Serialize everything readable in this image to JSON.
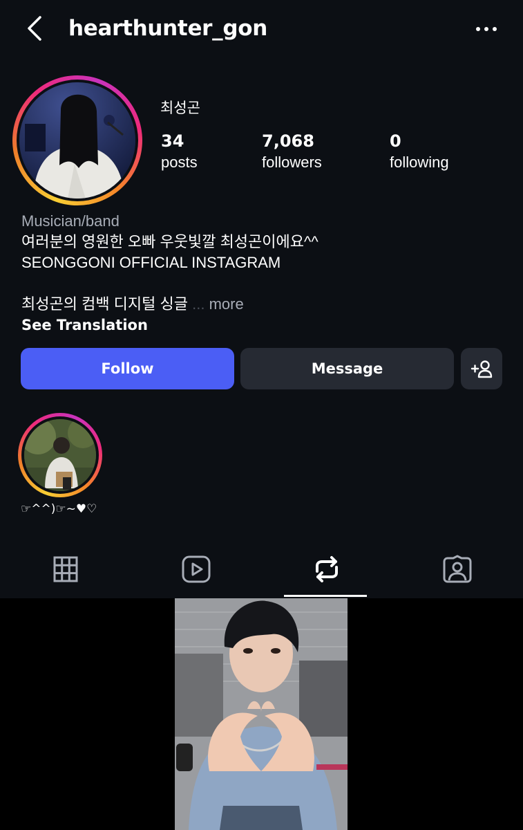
{
  "header": {
    "username": "hearthunter_gon",
    "back_icon": "chevron-left-icon",
    "more_icon": "ellipsis-icon"
  },
  "profile": {
    "display_name": "최성곤",
    "stats": [
      {
        "value": "34",
        "label": "posts"
      },
      {
        "value": "7,068",
        "label": "followers"
      },
      {
        "value": "0",
        "label": "following"
      }
    ]
  },
  "bio": {
    "category": "Musician/band",
    "line1": "여러분의 영원한 오빠 우웃빛깔 최성곤이에요^^",
    "line2": "SEONGGONI OFFICIAL INSTAGRAM",
    "line3": "최성곤의 컴백 디지털 싱글",
    "ellipsis": "...",
    "more": "more",
    "see_translation": "See Translation"
  },
  "actions": {
    "follow": "Follow",
    "message": "Message",
    "add_user_icon": "add-user-icon"
  },
  "highlights": [
    {
      "label": "☞^^)☞~♥♡"
    }
  ],
  "tabs": [
    {
      "icon": "grid-icon"
    },
    {
      "icon": "reels-icon"
    },
    {
      "icon": "reposts-icon",
      "selected": true
    },
    {
      "icon": "tagged-icon"
    }
  ],
  "colors": {
    "background": "#0c0f14",
    "follow_button": "#4b5ef5",
    "secondary_button": "#262a33",
    "muted_text": "#a8adb7"
  }
}
